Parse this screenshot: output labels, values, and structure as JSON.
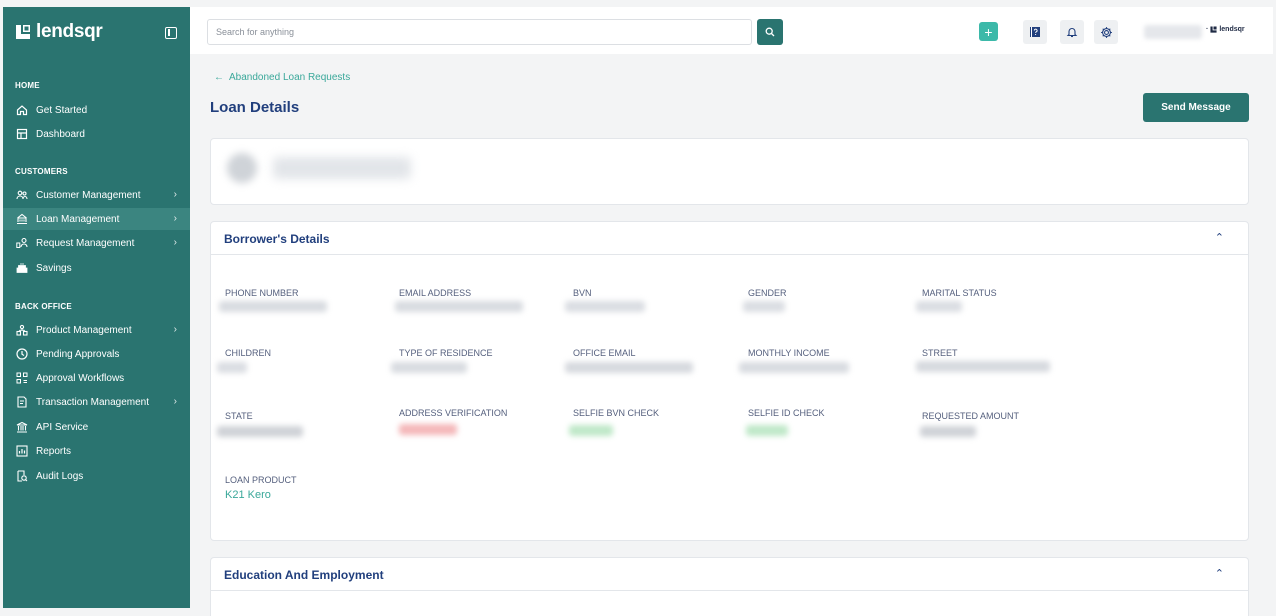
{
  "sidebar": {
    "logo_text": "lendsqr",
    "sections": [
      {
        "label": "HOME",
        "items": [
          {
            "label": "Get Started",
            "icon": "home-icon"
          },
          {
            "label": "Dashboard",
            "icon": "dashboard-icon"
          }
        ]
      },
      {
        "label": "CUSTOMERS",
        "items": [
          {
            "label": "Customer Management",
            "icon": "users-icon",
            "has_submenu": true
          },
          {
            "label": "Loan Management",
            "icon": "loan-icon",
            "has_submenu": true,
            "active": true
          },
          {
            "label": "Request Management",
            "icon": "request-icon",
            "has_submenu": true
          },
          {
            "label": "Savings",
            "icon": "savings-icon"
          }
        ]
      },
      {
        "label": "BACK OFFICE",
        "items": [
          {
            "label": "Product Management",
            "icon": "product-icon",
            "has_submenu": true
          },
          {
            "label": "Pending Approvals",
            "icon": "clock-icon"
          },
          {
            "label": "Approval Workflows",
            "icon": "workflow-icon"
          },
          {
            "label": "Transaction Management",
            "icon": "transaction-icon",
            "has_submenu": true
          },
          {
            "label": "API Service",
            "icon": "bank-icon"
          },
          {
            "label": "Reports",
            "icon": "report-icon"
          },
          {
            "label": "Audit Logs",
            "icon": "audit-icon"
          }
        ]
      }
    ]
  },
  "topbar": {
    "search_placeholder": "Search for anything",
    "profile_brand": "lendsqr"
  },
  "page": {
    "back_link": "Abandoned Loan Requests",
    "title": "Loan Details",
    "send_message_label": "Send Message"
  },
  "borrower": {
    "title": "Borrower's Details",
    "fields": [
      {
        "label": "PHONE NUMBER"
      },
      {
        "label": "EMAIL ADDRESS"
      },
      {
        "label": "BVN"
      },
      {
        "label": "GENDER"
      },
      {
        "label": "MARITAL STATUS"
      },
      {
        "label": "CHILDREN"
      },
      {
        "label": "TYPE OF RESIDENCE"
      },
      {
        "label": "OFFICE EMAIL"
      },
      {
        "label": "MONTHLY INCOME"
      },
      {
        "label": "STREET"
      },
      {
        "label": "STATE"
      },
      {
        "label": "ADDRESS VERIFICATION"
      },
      {
        "label": "SELFIE BVN CHECK"
      },
      {
        "label": "SELFIE ID CHECK"
      },
      {
        "label": "REQUESTED AMOUNT"
      },
      {
        "label": "LOAN PRODUCT",
        "value": "K21 Kero"
      }
    ]
  },
  "education": {
    "title": "Education And Employment"
  },
  "colors": {
    "sidebar_bg": "#2a7470",
    "accent_teal": "#3aa89a",
    "title_navy": "#213f7d",
    "verify_red": "#f4b7b9",
    "verify_green": "#bfe8c8"
  }
}
